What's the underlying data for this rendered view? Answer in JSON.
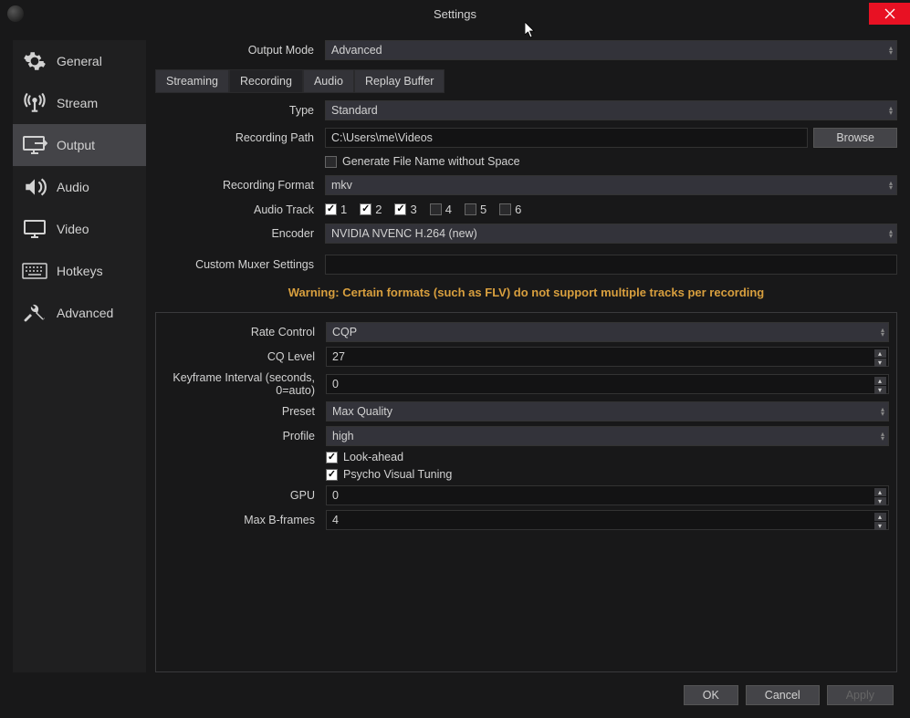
{
  "window": {
    "title": "Settings"
  },
  "sidebar": {
    "items": [
      {
        "label": "General"
      },
      {
        "label": "Stream"
      },
      {
        "label": "Output"
      },
      {
        "label": "Audio"
      },
      {
        "label": "Video"
      },
      {
        "label": "Hotkeys"
      },
      {
        "label": "Advanced"
      }
    ]
  },
  "output_mode": {
    "label": "Output Mode",
    "value": "Advanced"
  },
  "tabs": {
    "streaming": "Streaming",
    "recording": "Recording",
    "audio": "Audio",
    "replay_buffer": "Replay Buffer"
  },
  "recording": {
    "type_label": "Type",
    "type_value": "Standard",
    "path_label": "Recording Path",
    "path_value": "C:\\Users\\me\\Videos",
    "browse": "Browse",
    "gen_no_space": "Generate File Name without Space",
    "format_label": "Recording Format",
    "format_value": "mkv",
    "audio_track_label": "Audio Track",
    "tracks": [
      "1",
      "2",
      "3",
      "4",
      "5",
      "6"
    ],
    "encoder_label": "Encoder",
    "encoder_value": "NVIDIA NVENC H.264 (new)",
    "muxer_label": "Custom Muxer Settings",
    "muxer_value": "",
    "warning": "Warning: Certain formats (such as FLV) do not support multiple tracks per recording"
  },
  "encoder": {
    "rate_control_label": "Rate Control",
    "rate_control_value": "CQP",
    "cq_label": "CQ Level",
    "cq_value": "27",
    "keyframe_label": "Keyframe Interval (seconds, 0=auto)",
    "keyframe_value": "0",
    "preset_label": "Preset",
    "preset_value": "Max Quality",
    "profile_label": "Profile",
    "profile_value": "high",
    "lookahead": "Look-ahead",
    "psycho": "Psycho Visual Tuning",
    "gpu_label": "GPU",
    "gpu_value": "0",
    "bframes_label": "Max B-frames",
    "bframes_value": "4"
  },
  "footer": {
    "ok": "OK",
    "cancel": "Cancel",
    "apply": "Apply"
  }
}
